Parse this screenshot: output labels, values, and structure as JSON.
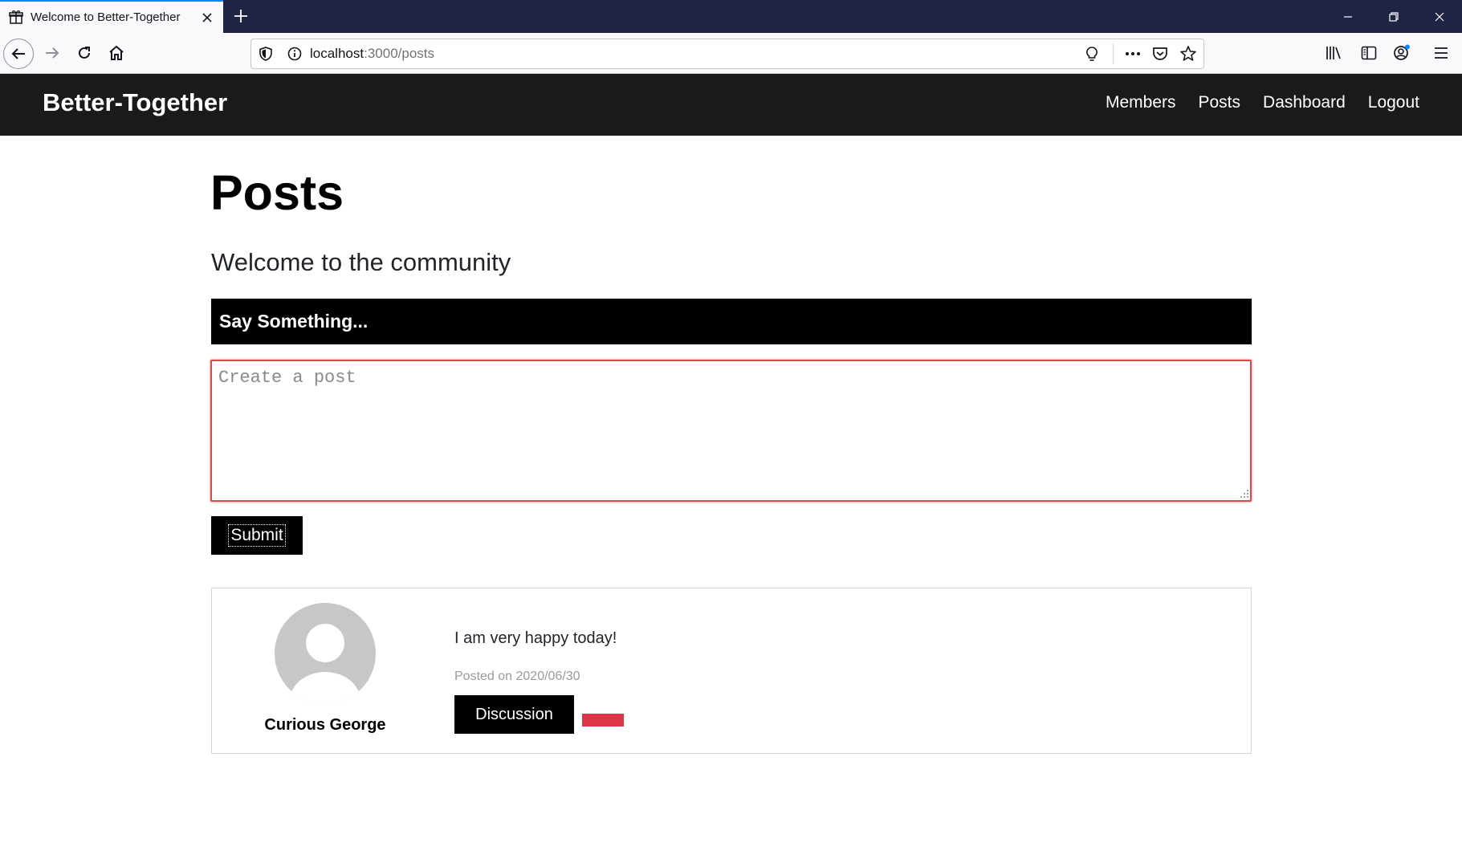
{
  "browser": {
    "tab_title": "Welcome to Better-Together",
    "url_host": "localhost",
    "url_path": ":3000/posts"
  },
  "site": {
    "brand": "Better-Together",
    "nav": {
      "members": "Members",
      "posts": "Posts",
      "dashboard": "Dashboard",
      "logout": "Logout"
    }
  },
  "page": {
    "title": "Posts",
    "subtitle": "Welcome to the community"
  },
  "composer": {
    "heading": "Say Something...",
    "placeholder": "Create a post",
    "value": "",
    "submit_label": "Submit"
  },
  "posts": [
    {
      "author": "Curious George",
      "body": "I am very happy today!",
      "date_text": "Posted on 2020/06/30",
      "discussion_label": "Discussion"
    }
  ],
  "colors": {
    "tabstrip": "#1f2344",
    "header": "#1a1a1a",
    "accent_black": "#000000",
    "danger": "#dc3545",
    "input_border": "#e04848"
  }
}
